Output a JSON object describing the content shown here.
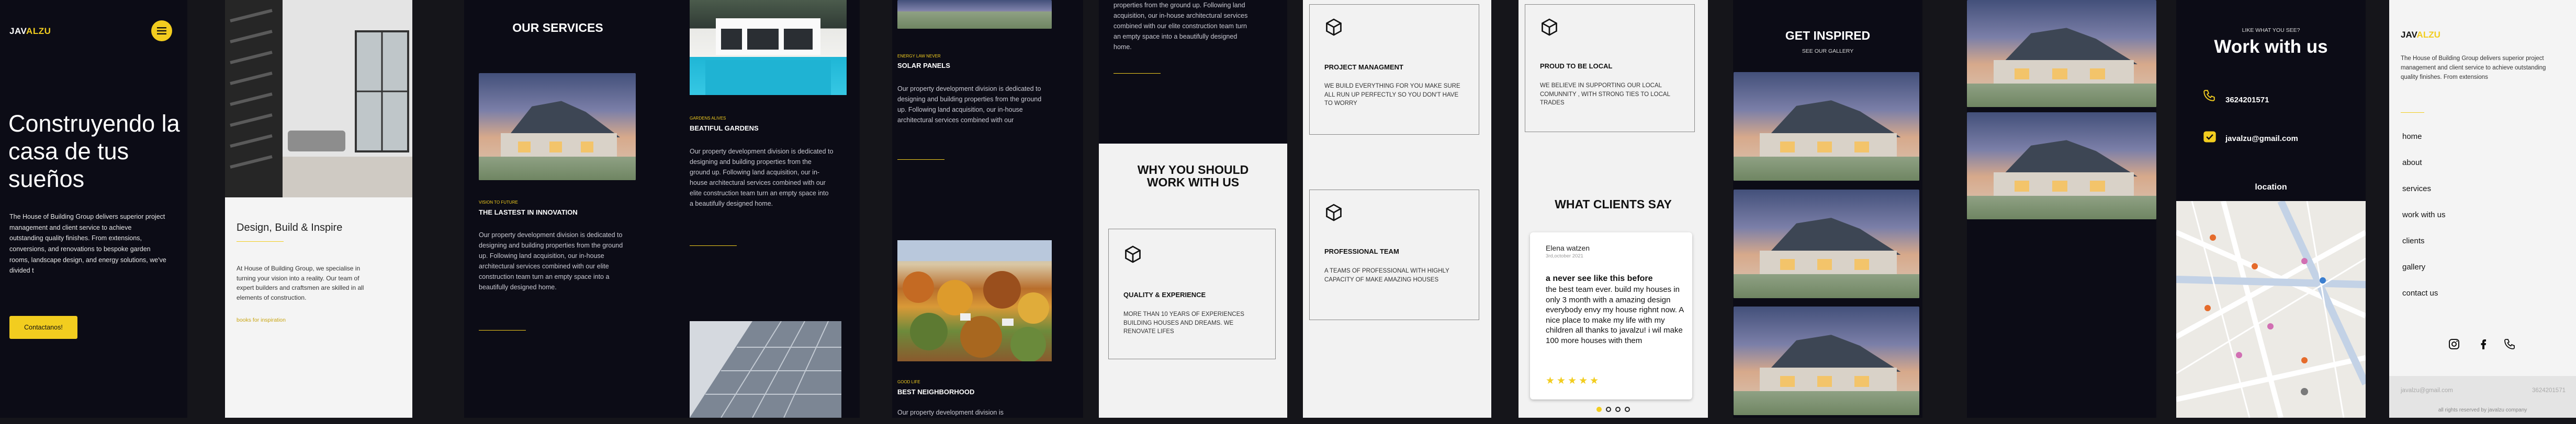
{
  "brand": {
    "left": "JAV",
    "right": "ALZU"
  },
  "hero": {
    "title": "Construyendo la casa de tus sueños",
    "body": "The House of Building Group delivers superior project management and client service to achieve outstanding quality finishes. From extensions, conversions, and renovations to bespoke garden rooms, landscape design, and energy solutions, we've divided t",
    "cta": "Contactanos!"
  },
  "design": {
    "title": "Design, Build & Inspire",
    "body": "At House of Building Group, we specialise in turning your vision into a reality. Our team of expert builders and craftsmen are skilled in all elements of construction.",
    "link": "books for inspiration"
  },
  "services": {
    "heading": "OUR SERVICES",
    "s1_kicker": "VISION TO FUTURE",
    "s1_title": "THE LASTEST IN INNOVATION",
    "s1_body": "Our property development division is dedicated to designing and building properties from the ground up. Following land acquisition, our in-house architectural services combined with our elite construction team turn an empty space into a beautifully designed home.",
    "s2_kicker": "GARDENS ALIVES",
    "s2_title": "BEATIFUL GARDENS",
    "s2_body": "Our property development division is dedicated to designing and building properties from the ground up. Following land acquisition, our in-house architectural services combined with our elite construction team turn an empty space into a beautifully designed home.",
    "s3_kicker": "ENERGY LAW NEVER",
    "s3_title": "SOLAR PANELS",
    "s3_body": "Our property development division is dedicated to designing and building properties from the ground up. Following land acquisition, our in-house architectural services combined with our",
    "s4_kicker": "GOOD LIFE",
    "s4_title": "BEST NEIGHBORHOOD",
    "s4_body": "Our property development division is",
    "s5_body": "properties from the ground up. Following land acquisition, our in-house architectural services combined with our elite construction team turn an empty space into a beautifully designed home."
  },
  "why": {
    "heading": "WHY YOU SHOULD WORK WITH US",
    "c1_title": "QUALITY & EXPERIENCE",
    "c1_body": "MORE THAN 10 YEARS OF EXPERIENCES BUILDING HOUSES AND DREAMS. WE RENOVATE LIFES",
    "c2_title": "PROJECT MANAGMENT",
    "c2_body": "WE BUILD EVERYTHING FOR YOU MAKE SURE ALL RUN UP PERFECTLY SO YOU DON'T HAVE TO WORRY",
    "c3_title": "PROFESSIONAL TEAM",
    "c3_body": "A TEAMS OF PROFESSIONAL WITH HIGHLY CAPACITY OF MAKE AMAZING HOUSES",
    "c4_title": "PROUD TO BE LOCAL",
    "c4_body": "WE BELIEVE IN SUPPORTING OUR LOCAL COMUNNITY , WITH STRONG TIES TO LOCAL TRADES"
  },
  "testimonials": {
    "heading": "WHAT CLIENTS SAY",
    "name": "Elena watzen",
    "date": "3rd,october 2021",
    "title": "a never see like this before",
    "body": "the best team ever. build my houses in only 3 month with a amazing design everybody envy my house righnt now. A nice place to make my life with my children all thanks to javalzu! i wil make 100 more houses with them",
    "stars": "★★★★★"
  },
  "gallery": {
    "heading": "GET INSPIRED",
    "sub": "SEE OUR GALLERY"
  },
  "contact": {
    "kicker": "LIKE WHAT YOU SEE?",
    "heading": "Work with us",
    "phone": "3624201571",
    "email": "javalzu@gmail.com",
    "location": "location"
  },
  "footer": {
    "about": "The House of Building Group delivers superior project management and client service to achieve outstanding quality finishes. From extensions",
    "nav": [
      "home",
      "about",
      "services",
      "work with us",
      "clients",
      "gallery",
      "contact us"
    ],
    "email": "javalzu@gmail.com",
    "phone": "3624201571",
    "copyright": "all rights reserved by javalzu company"
  },
  "colors": {
    "accent": "#f2cd1f",
    "dark": "#0c0c16",
    "light": "#f2f2f2"
  }
}
